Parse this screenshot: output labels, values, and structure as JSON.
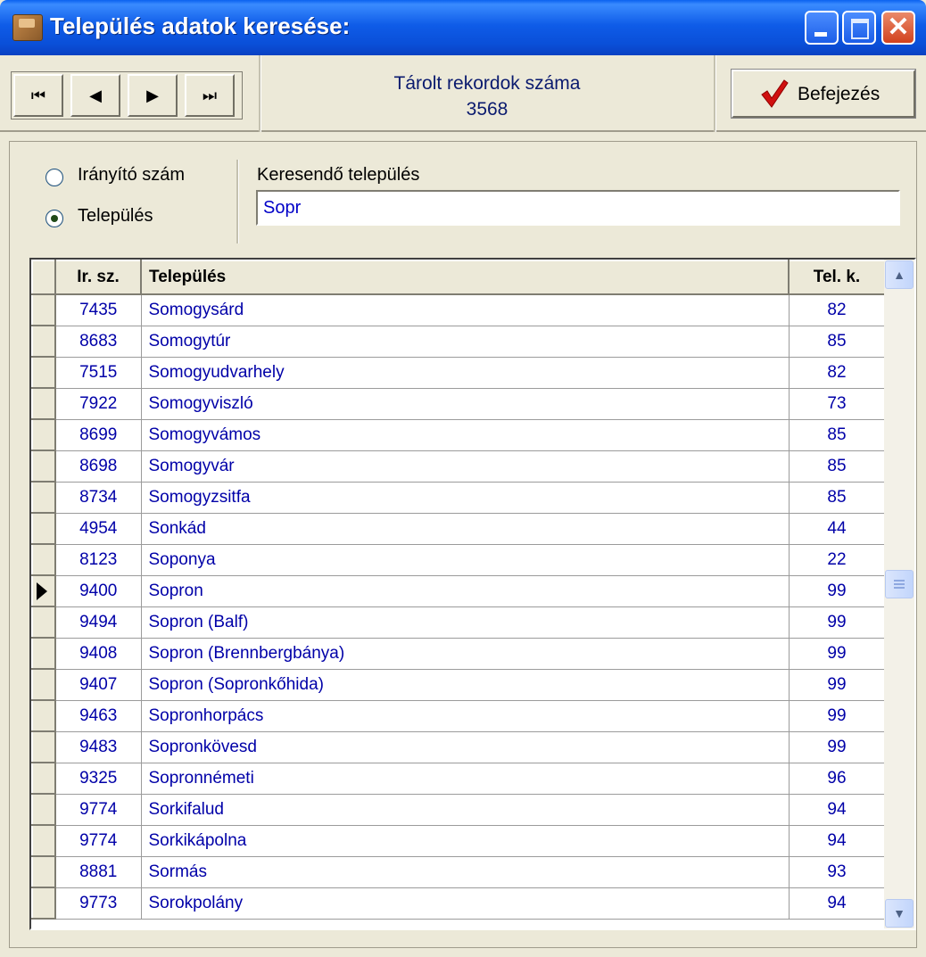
{
  "window": {
    "title": "Település adatok keresése:",
    "close_glyph": "✕"
  },
  "toolbar": {
    "nav": {
      "first_glyph": "⏮",
      "prev_glyph": "◀",
      "next_glyph": "▶",
      "last_glyph": "⏭"
    },
    "record_label": "Tárolt rekordok száma",
    "record_count": "3568",
    "finish_label": "Befejezés"
  },
  "filter": {
    "options": [
      {
        "label": "Irányító szám",
        "selected": false
      },
      {
        "label": "Település",
        "selected": true
      }
    ],
    "search_label": "Keresendő település",
    "search_value": "Sopr"
  },
  "grid": {
    "columns": [
      "Ir. sz.",
      "Település",
      "Tel. k."
    ],
    "rows": [
      {
        "zip": "7435",
        "name": "Somogysárd",
        "tel": "82"
      },
      {
        "zip": "8683",
        "name": "Somogytúr",
        "tel": "85"
      },
      {
        "zip": "7515",
        "name": "Somogyudvarhely",
        "tel": "82"
      },
      {
        "zip": "7922",
        "name": "Somogyviszló",
        "tel": "73"
      },
      {
        "zip": "8699",
        "name": "Somogyvámos",
        "tel": "85"
      },
      {
        "zip": "8698",
        "name": "Somogyvár",
        "tel": "85"
      },
      {
        "zip": "8734",
        "name": "Somogyzsitfa",
        "tel": "85"
      },
      {
        "zip": "4954",
        "name": "Sonkád",
        "tel": "44"
      },
      {
        "zip": "8123",
        "name": "Soponya",
        "tel": "22"
      },
      {
        "zip": "9400",
        "name": "Sopron",
        "tel": "99",
        "current": true
      },
      {
        "zip": "9494",
        "name": "Sopron (Balf)",
        "tel": "99"
      },
      {
        "zip": "9408",
        "name": "Sopron (Brennbergbánya)",
        "tel": "99"
      },
      {
        "zip": "9407",
        "name": "Sopron (Sopronkőhida)",
        "tel": "99"
      },
      {
        "zip": "9463",
        "name": "Sopronhorpács",
        "tel": "99"
      },
      {
        "zip": "9483",
        "name": "Sopronkövesd",
        "tel": "99"
      },
      {
        "zip": "9325",
        "name": "Sopronnémeti",
        "tel": "96"
      },
      {
        "zip": "9774",
        "name": "Sorkifalud",
        "tel": "94"
      },
      {
        "zip": "9774",
        "name": "Sorkikápolna",
        "tel": "94"
      },
      {
        "zip": "8881",
        "name": "Sormás",
        "tel": "93"
      },
      {
        "zip": "9773",
        "name": "Sorokpolány",
        "tel": "94"
      }
    ],
    "scroll_up_glyph": "▲",
    "scroll_down_glyph": "▼"
  }
}
